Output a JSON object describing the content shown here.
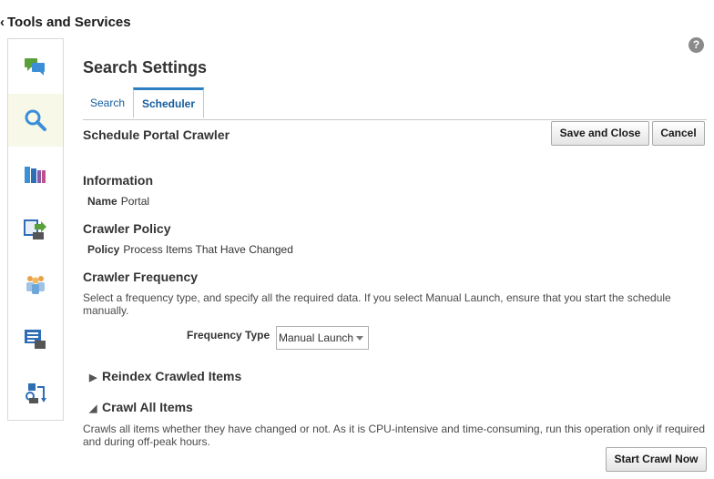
{
  "app": {
    "title": "Tools and Services"
  },
  "page": {
    "title": "Search Settings"
  },
  "tabs": [
    {
      "label": "Search"
    },
    {
      "label": "Scheduler"
    }
  ],
  "section": {
    "title": "Schedule Portal Crawler"
  },
  "actions": {
    "save_close": "Save and Close",
    "cancel": "Cancel"
  },
  "information": {
    "title": "Information",
    "name_label": "Name",
    "name_value": "Portal"
  },
  "policy": {
    "title": "Crawler Policy",
    "policy_label": "Policy",
    "policy_value": "Process Items That Have Changed"
  },
  "frequency": {
    "title": "Crawler Frequency",
    "description": "Select a frequency type, and specify all the required data. If you select Manual Launch, ensure that you start the schedule manually.",
    "type_label": "Frequency Type",
    "type_value": "Manual Launch"
  },
  "reindex": {
    "title": "Reindex Crawled Items",
    "expanded": false
  },
  "crawl_all": {
    "title": "Crawl All Items",
    "expanded": true,
    "description": "Crawls all items whether they have changed or not. As it is CPU-intensive and time-consuming, run this operation only if required and during off-peak hours.",
    "start_button": "Start Crawl Now"
  },
  "sidebar": {
    "items": [
      {
        "icon": "conversation-icon"
      },
      {
        "icon": "search-icon",
        "selected": true
      },
      {
        "icon": "library-icon"
      },
      {
        "icon": "export-icon"
      },
      {
        "icon": "group-icon"
      },
      {
        "icon": "reports-icon"
      },
      {
        "icon": "flow-icon"
      }
    ]
  },
  "colors": {
    "accent": "#2d7fc1",
    "link": "#145c9e",
    "selected_bg": "#f8f8e8"
  }
}
